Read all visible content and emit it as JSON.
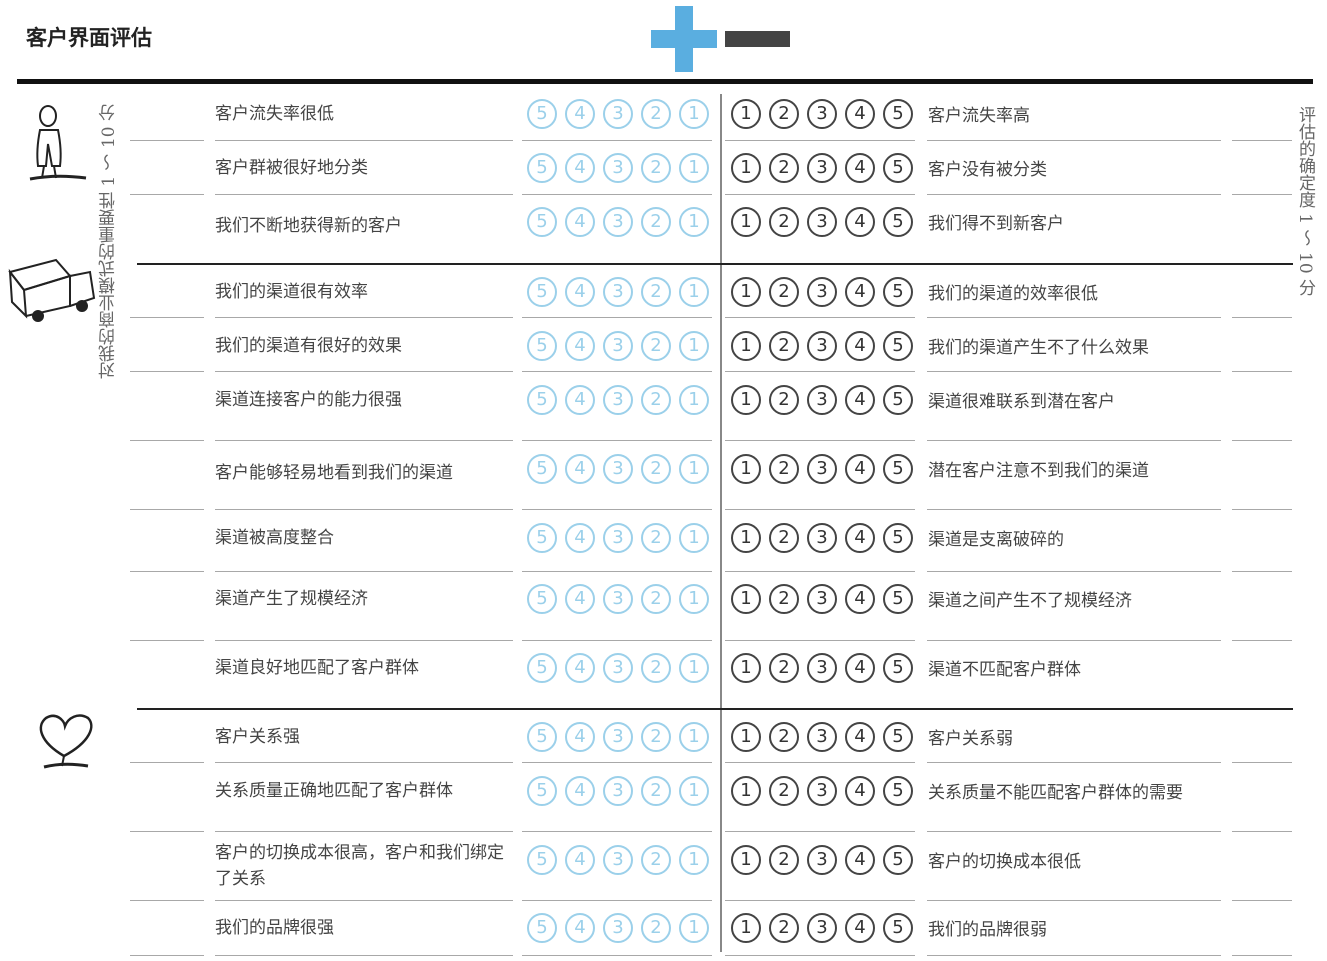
{
  "title": "客户界面评估",
  "left_vertical": "对我的商业模式的重要性 1 ～ 10 分",
  "right_vertical": "评估的确定度 1 ～ 10 分",
  "colors": {
    "positive": "#5aaee0",
    "negative": "#444444",
    "scale_positive": "#9bd0ea"
  },
  "icons": [
    "person-icon",
    "truck-icon",
    "heart-icon"
  ],
  "scale_left": [
    "5",
    "4",
    "3",
    "2",
    "1"
  ],
  "scale_right": [
    "1",
    "2",
    "3",
    "4",
    "5"
  ],
  "rows": [
    {
      "pos": "客户流失率很低",
      "neg": "客户流失率高"
    },
    {
      "pos": "客户群被很好地分类",
      "neg": "客户没有被分类"
    },
    {
      "pos": "我们不断地获得新的客户",
      "neg": "我们得不到新客户"
    },
    {
      "pos": "我们的渠道很有效率",
      "neg": "我们的渠道的效率很低"
    },
    {
      "pos": "我们的渠道有很好的效果",
      "neg": "我们的渠道产生不了什么效果"
    },
    {
      "pos": "渠道连接客户的能力很强",
      "neg": "渠道很难联系到潜在客户"
    },
    {
      "pos": "客户能够轻易地看到我们的渠道",
      "neg": "潜在客户注意不到我们的渠道"
    },
    {
      "pos": "渠道被高度整合",
      "neg": "渠道是支离破碎的"
    },
    {
      "pos": "渠道产生了规模经济",
      "neg": "渠道之间产生不了规模经济"
    },
    {
      "pos": "渠道良好地匹配了客户群体",
      "neg": "渠道不匹配客户群体"
    },
    {
      "pos": "客户关系强",
      "neg": "客户关系弱"
    },
    {
      "pos": "关系质量正确地匹配了客户群体",
      "neg": "关系质量不能匹配客户群体的需要"
    },
    {
      "pos": "客户的切换成本很高，客户和我们绑定了关系",
      "neg": "客户的切换成本很低"
    },
    {
      "pos": "我们的品牌很强",
      "neg": "我们的品牌很弱"
    }
  ]
}
